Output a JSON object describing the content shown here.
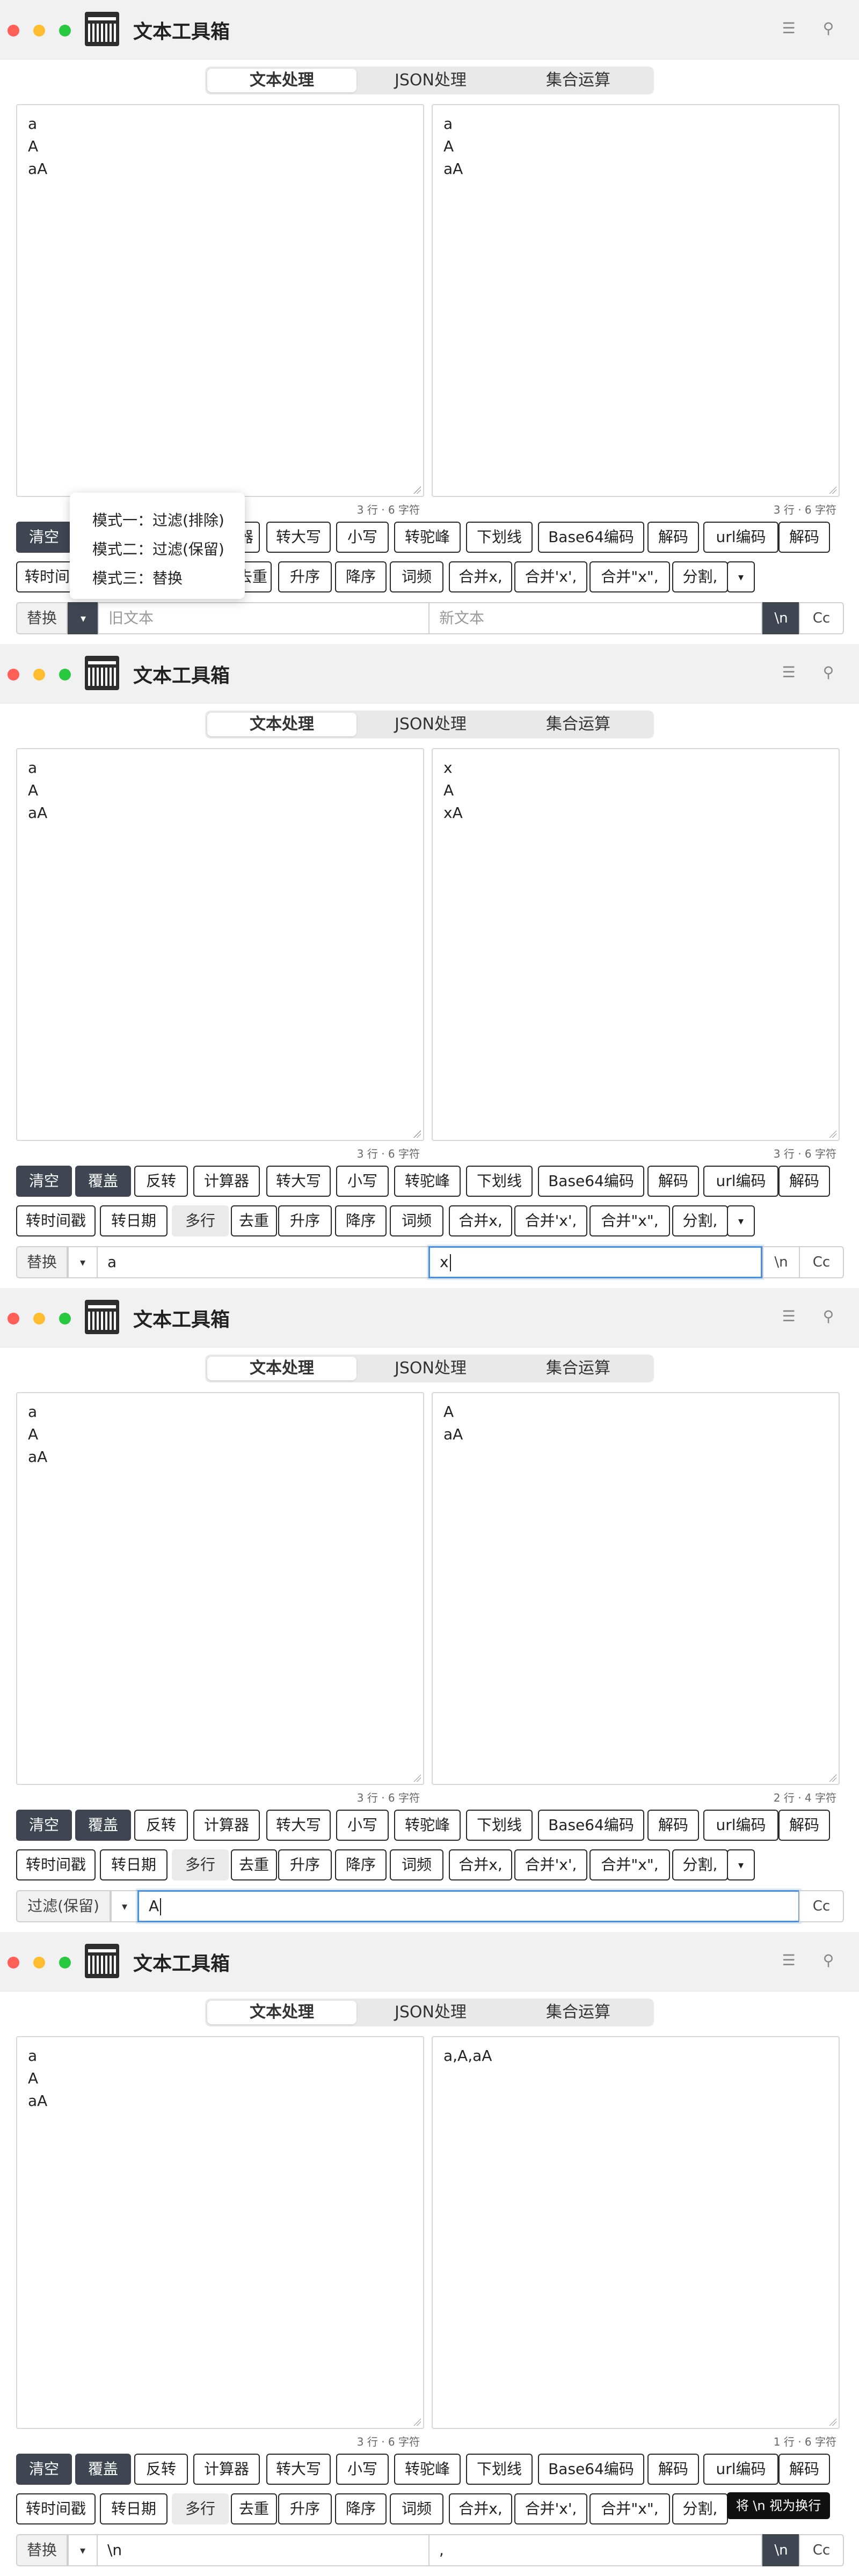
{
  "app": {
    "title": "文本工具箱",
    "tabs": [
      "文本处理",
      "JSON处理",
      "集合运算"
    ],
    "menu_icon": "hamburger-icon",
    "pin_icon": "pin-icon"
  },
  "toolbar": {
    "row1": [
      "清空",
      "覆盖",
      "反转",
      "计算器",
      "转大写",
      "小写",
      "转驼峰",
      "下划线",
      "Base64编码",
      "解码",
      "url编码",
      "解码"
    ],
    "row2": [
      "转时间戳",
      "转日期",
      "多行",
      "去重",
      "升序",
      "降序",
      "词频",
      "合并x,",
      "合并'x',",
      "合并\"x\",",
      "分割,",
      "▾"
    ]
  },
  "panels": [
    {
      "left_lines": [
        "a",
        "A",
        "aA"
      ],
      "right_lines": [
        "a",
        "A",
        "aA"
      ],
      "left_count": "3 行 · 6 字符",
      "right_count": "3 行 · 6 字符",
      "mode": "替换",
      "input1_placeholder": "旧文本",
      "input2_placeholder": "新文本",
      "dropdown": [
        "模式一：过滤(排除)",
        "模式二：过滤(保留)",
        "模式三：替换"
      ],
      "nl_label": "\\n",
      "case_label": "Cc"
    },
    {
      "left_lines": [
        "a",
        "A",
        "aA"
      ],
      "right_lines": [
        "x",
        "A",
        "xA"
      ],
      "left_count": "3 行 · 6 字符",
      "right_count": "3 行 · 6 字符",
      "mode": "替换",
      "input1_value": "a",
      "input2_value": "x",
      "nl_label": "\\n",
      "case_label": "Cc"
    },
    {
      "left_lines": [
        "a",
        "A",
        "aA"
      ],
      "right_lines": [
        "A",
        "aA"
      ],
      "left_count": "3 行 · 6 字符",
      "right_count": "2 行 · 4 字符",
      "mode": "过滤(保留)",
      "input1_value": "A",
      "case_label": "Cc"
    },
    {
      "left_lines": [
        "a",
        "A",
        "aA"
      ],
      "right_lines": [
        "a,A,aA"
      ],
      "left_count": "3 行 · 6 字符",
      "right_count": "1 行 · 6 字符",
      "mode": "替换",
      "input1_value": "\\n",
      "input2_value": ",",
      "nl_label": "\\n",
      "case_label": "Cc",
      "tooltip": "将 \\n 视为换行"
    }
  ]
}
